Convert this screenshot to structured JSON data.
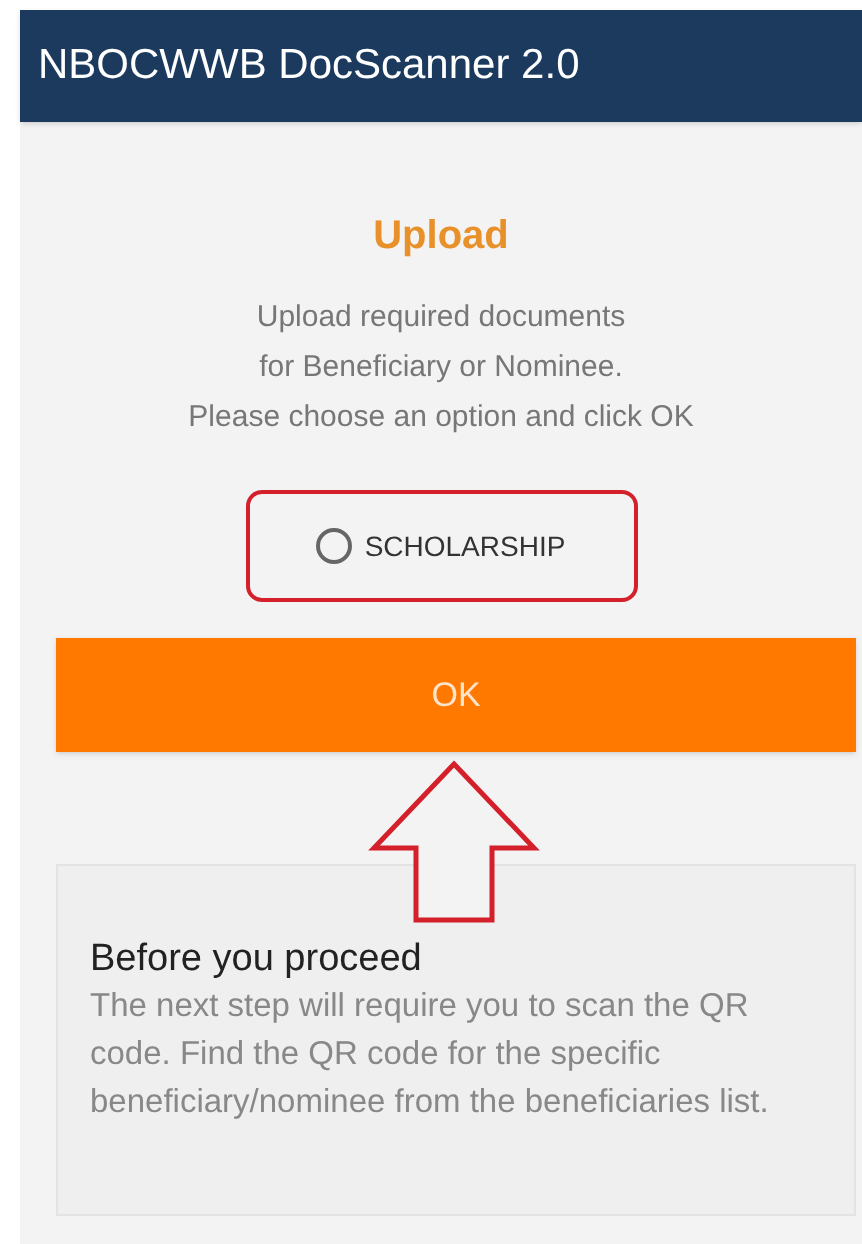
{
  "app_bar": {
    "title": "NBOCWWB DocScanner 2.0"
  },
  "dialog": {
    "title": "Upload",
    "message": [
      "Upload required documents",
      "for Beneficiary or Nominee.",
      "Please choose an option and click OK"
    ],
    "options": [
      {
        "label": "SCHOLARSHIP",
        "selected": false
      }
    ],
    "ok_button": "OK"
  },
  "info_card": {
    "title": "Before you proceed",
    "text": "The next step will require you to scan the QR code. Find the QR code for the specific beneficiary/nominee from the beneficiaries list."
  }
}
